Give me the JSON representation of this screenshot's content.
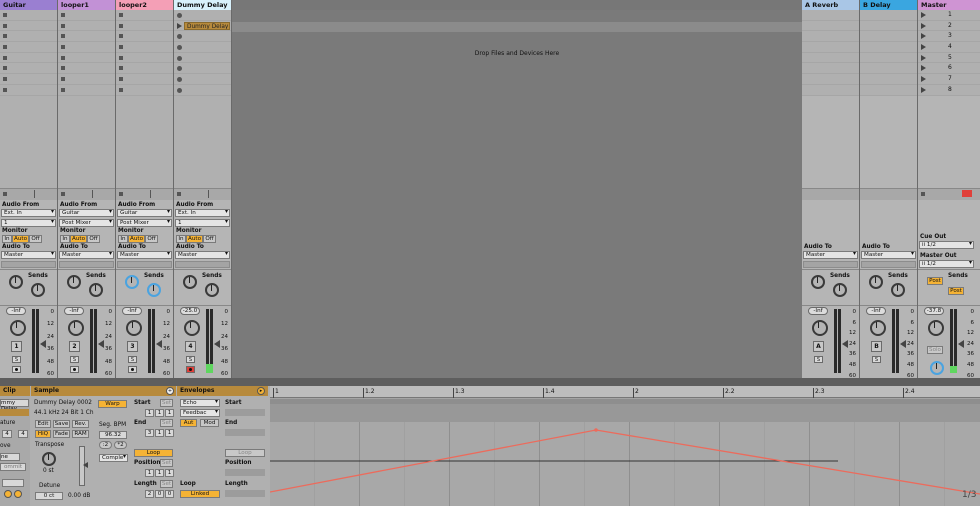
{
  "tracks": [
    {
      "name": "Guitar",
      "color": "#9a7fd1",
      "num": "1",
      "audio_from": "Ext. In",
      "channel": "1",
      "audio_to": "Master",
      "vol": "-Inf",
      "sub": ""
    },
    {
      "name": "looper1",
      "color": "#c291d6",
      "num": "2",
      "audio_from": "Guitar",
      "channel": "Post Mixer",
      "audio_to": "Master",
      "vol": "-Inf",
      "sub": ""
    },
    {
      "name": "looper2",
      "color": "#f49fb6",
      "num": "3",
      "audio_from": "Guitar",
      "channel": "Post Mixer",
      "audio_to": "Master",
      "vol": "-Inf",
      "sub": ""
    },
    {
      "name": "Dummy Delay",
      "color": "#d8f1fb",
      "num": "4",
      "audio_from": "Ext. In",
      "channel": "1",
      "audio_to": "Master",
      "vol": "-25.0",
      "sub": ""
    }
  ],
  "clip_name": "Dummy Delay 2",
  "drop_text": "Drop Files and Devices Here",
  "returns": [
    {
      "name": "A Reverb",
      "color": "#a9c6e6",
      "letter": "A",
      "audio_to": "Master",
      "vol": "-Inf"
    },
    {
      "name": "B Delay",
      "color": "#3aa6e0",
      "letter": "B",
      "audio_to": "Master",
      "vol": "-Inf"
    }
  ],
  "master": {
    "name": "Master",
    "color": "#cf94d3",
    "scenes": [
      "1",
      "2",
      "3",
      "4",
      "5",
      "6",
      "7",
      "8"
    ],
    "cue_out_label": "Cue Out",
    "cue_out": "ii 1/2",
    "master_out_label": "Master Out",
    "master_out": "ii 1/2",
    "vol": "-37.8",
    "solo": "Solo",
    "post": "Post"
  },
  "labels": {
    "audio_from": "Audio From",
    "monitor": "Monitor",
    "audio_to": "Audio To",
    "sends": "Sends",
    "in": "In",
    "auto": "Auto",
    "off": "Off",
    "s": "S"
  },
  "meter_scale": [
    "0",
    "12",
    "24",
    "36",
    "48",
    "60"
  ],
  "meter_scale_with_6": [
    "0",
    "6",
    "12",
    "24",
    "36",
    "48",
    "60"
  ],
  "clip_panel": {
    "clip_hdr": "Clip",
    "clip_name": "mmy Delay",
    "signature_label": "ature",
    "sig_val": "4",
    "sample_hdr": "Sample",
    "sample_name": "Dummy Delay 0002",
    "sample_info": "44.1 kHz 24 Bit 1 Ch",
    "edit": "Edit",
    "save": "Save",
    "rev": "Rev.",
    "hiq": "HiQ",
    "fade": "Fade",
    "ram": "RAM",
    "transpose": "Transpose",
    "transpose_val": "0 st",
    "detune": "Detune",
    "detune_val": "0 ct",
    "gain_val": "0.00 dB",
    "warp": "Warp",
    "seg_bpm": "Seg. BPM",
    "bpm": "96.32",
    "half": ":2",
    "double": "*2",
    "mode": "Comple",
    "start": "Start",
    "set": "Set",
    "end": "End",
    "loop": "Loop",
    "position": "Position",
    "length": "Length",
    "start_vals": [
      "1",
      "1",
      "1"
    ],
    "end_vals": [
      "3",
      "1",
      "1"
    ],
    "pos_vals": [
      "1",
      "1",
      "1"
    ],
    "len_vals": [
      "2",
      "0",
      "0"
    ],
    "left_labels": [
      "ove",
      "ne",
      "ommit"
    ]
  },
  "env_panel": {
    "hdr": "Envelopes",
    "device": "Echo",
    "param": "Feedbac",
    "aut": "Aut",
    "mod": "Mod",
    "start": "Start",
    "end": "End",
    "loop": "Loop",
    "position": "Position",
    "length": "Length",
    "linked": "Linked"
  },
  "ruler": [
    "1",
    "1.2",
    "1.3",
    "1.4",
    "2",
    "2.2",
    "2.3",
    "2.4"
  ],
  "page_indicator": "1/3"
}
